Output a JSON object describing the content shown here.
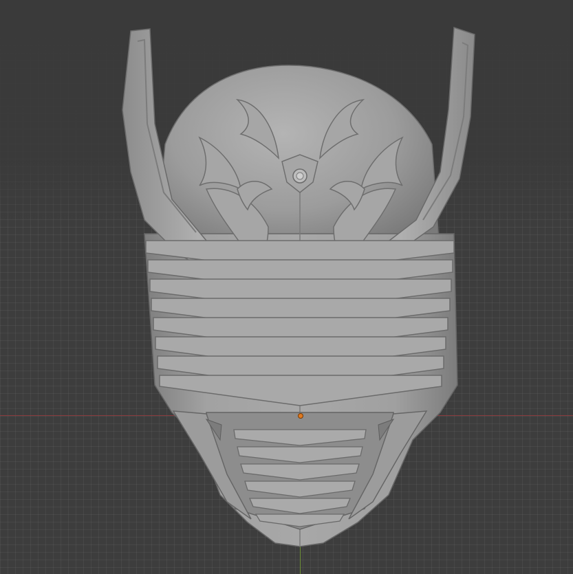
{
  "viewport": {
    "background": "#3d3d3d",
    "grid_color": "#4a4a4a",
    "axis_x_color": "#8a3a3e",
    "axis_y_color": "#6d8f35",
    "origin_color": "#e07a21"
  },
  "model": {
    "name": "helmet-mesh",
    "shading": "solid",
    "surface_color": "#9a9a9a",
    "upper_vent_count": 8,
    "lower_vent_count": 6
  }
}
